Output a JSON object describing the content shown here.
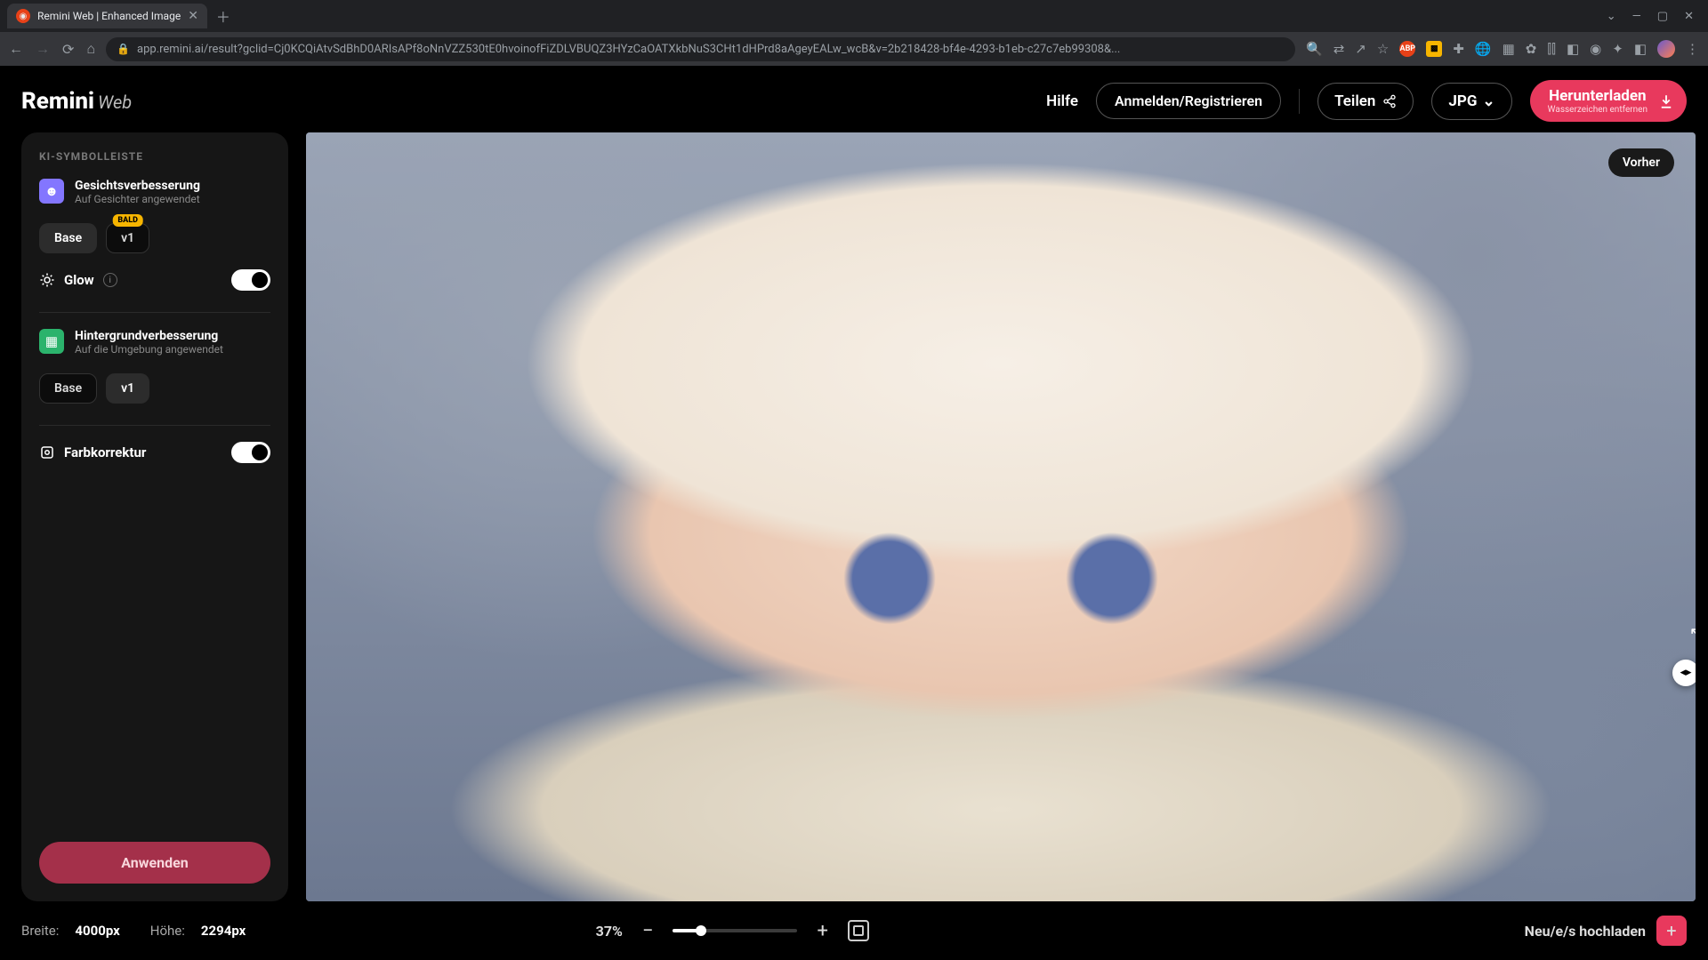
{
  "browser": {
    "tab_title": "Remini Web | Enhanced Image",
    "url": "app.remini.ai/result?gclid=Cj0KCQiAtvSdBhD0ARIsAPf8oNnVZZ530tE0hvoinofFiZDLVBUQZ3HYzCaOATXkbNuS3CHt1dHPrd8aAgeyEALw_wcB&v=2b218428-bf4e-4293-b1eb-c27c7eb99308&..."
  },
  "logo": {
    "main": "Remini",
    "sub": "Web"
  },
  "header": {
    "help": "Hilfe",
    "login": "Anmelden/Registrieren",
    "share": "Teilen",
    "format": "JPG",
    "download": "Herunterladen",
    "download_sub": "Wasserzeichen entfernen"
  },
  "sidebar": {
    "label": "KI-SYMBOLLEISTE",
    "face": {
      "title": "Gesichtsverbesserung",
      "sub": "Auf Gesichter angewendet",
      "base": "Base",
      "v1": "v1",
      "badge": "BALD"
    },
    "glow": {
      "label": "Glow"
    },
    "bg": {
      "title": "Hintergrundverbesserung",
      "sub": "Auf die Umgebung angewendet",
      "base": "Base",
      "v1": "v1"
    },
    "color": {
      "label": "Farbkorrektur"
    },
    "apply": "Anwenden"
  },
  "canvas": {
    "before": "Vorher"
  },
  "bottom": {
    "width_label": "Breite:",
    "width_val": "4000px",
    "height_label": "Höhe:",
    "height_val": "2294px",
    "zoom": "37%",
    "upload": "Neu/e/s hochladen"
  }
}
